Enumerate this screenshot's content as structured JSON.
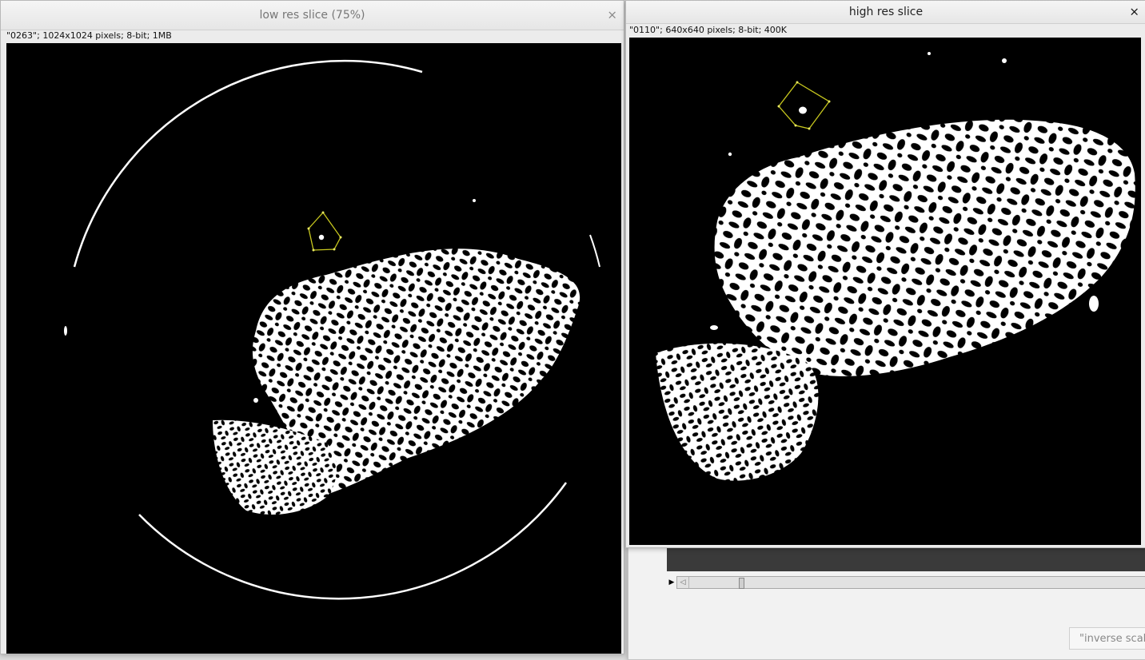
{
  "low_res_window": {
    "title": "low res slice (75%)",
    "close_glyph": "×",
    "info": "\"0263\"; 1024x1024 pixels; 8-bit; 1MB"
  },
  "high_res_window": {
    "title": "high res slice",
    "close_glyph": "×",
    "info": "\"0110\"; 640x640 pixels; 8-bit; 400K"
  },
  "stack_window": {
    "play_glyph": "▶",
    "scroll_left_glyph": "◁",
    "slice_position": 0.11,
    "scale_field": "\"inverse scale"
  },
  "colors": {
    "roi": "#c8c81e",
    "bone": "#ffffff",
    "background": "#000000",
    "title_active": "#222222",
    "title_inactive": "#777777"
  },
  "icons": [
    "close-icon",
    "play-icon",
    "scroll-left-icon"
  ]
}
